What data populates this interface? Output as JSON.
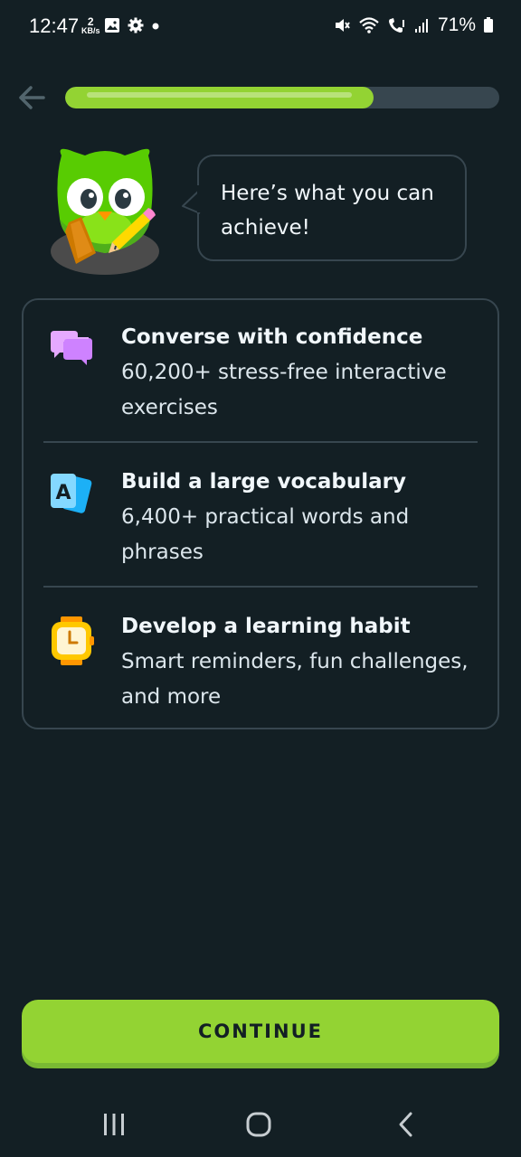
{
  "status_bar": {
    "time": "12:47",
    "net_speed_value": "2",
    "net_speed_unit": "KB/s",
    "battery": "71%",
    "icons": [
      "gallery-icon",
      "settings-gear-icon",
      "dot-icon",
      "mute-icon",
      "wifi-icon",
      "volte-call-icon",
      "signal-icon",
      "battery-icon"
    ]
  },
  "header": {
    "back_icon": "arrow-left-icon",
    "progress_fraction": 0.71
  },
  "mascot": {
    "icon": "owl-mascot-icon",
    "bubble_text": "Here’s what you can achieve!"
  },
  "features": [
    {
      "icon": "chat-bubbles-icon",
      "title": "Converse with confidence",
      "description": "60,200+ stress-free interactive exercises"
    },
    {
      "icon": "vocabulary-cards-icon",
      "icon_letter": "A",
      "title": "Build a large vocabulary",
      "description": "6,400+ practical words and phrases"
    },
    {
      "icon": "watch-icon",
      "title": "Develop a learning habit",
      "description": "Smart reminders, fun challenges, and more"
    }
  ],
  "continue_button": {
    "label": "CONTINUE"
  },
  "navigation_bar": {
    "icons": [
      "recent-apps-icon",
      "home-icon",
      "back-icon"
    ]
  },
  "colors": {
    "background": "#131f24",
    "accent_green": "#93d333",
    "border": "#37464f"
  }
}
